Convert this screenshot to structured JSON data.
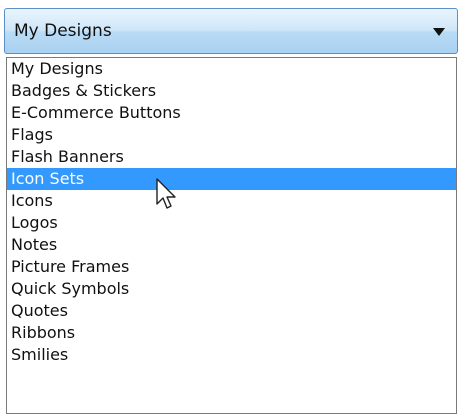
{
  "dropdown": {
    "selected_value": "My Designs",
    "options": [
      "My Designs",
      "Badges & Stickers",
      "E-Commerce Buttons",
      "Flags",
      "Flash Banners",
      "Icon Sets",
      "Icons",
      "Logos",
      "Notes",
      "Picture Frames",
      "Quick Symbols",
      "Quotes",
      "Ribbons",
      "Smilies"
    ],
    "highlighted_option": "Icon Sets"
  },
  "icons": {
    "dropdown_arrow": "chevron-down-icon",
    "cursor": "mouse-pointer-icon"
  },
  "colors": {
    "highlight": "#3399ff",
    "highlight_text": "#ffffff",
    "combo_border": "#5a8fc9"
  }
}
